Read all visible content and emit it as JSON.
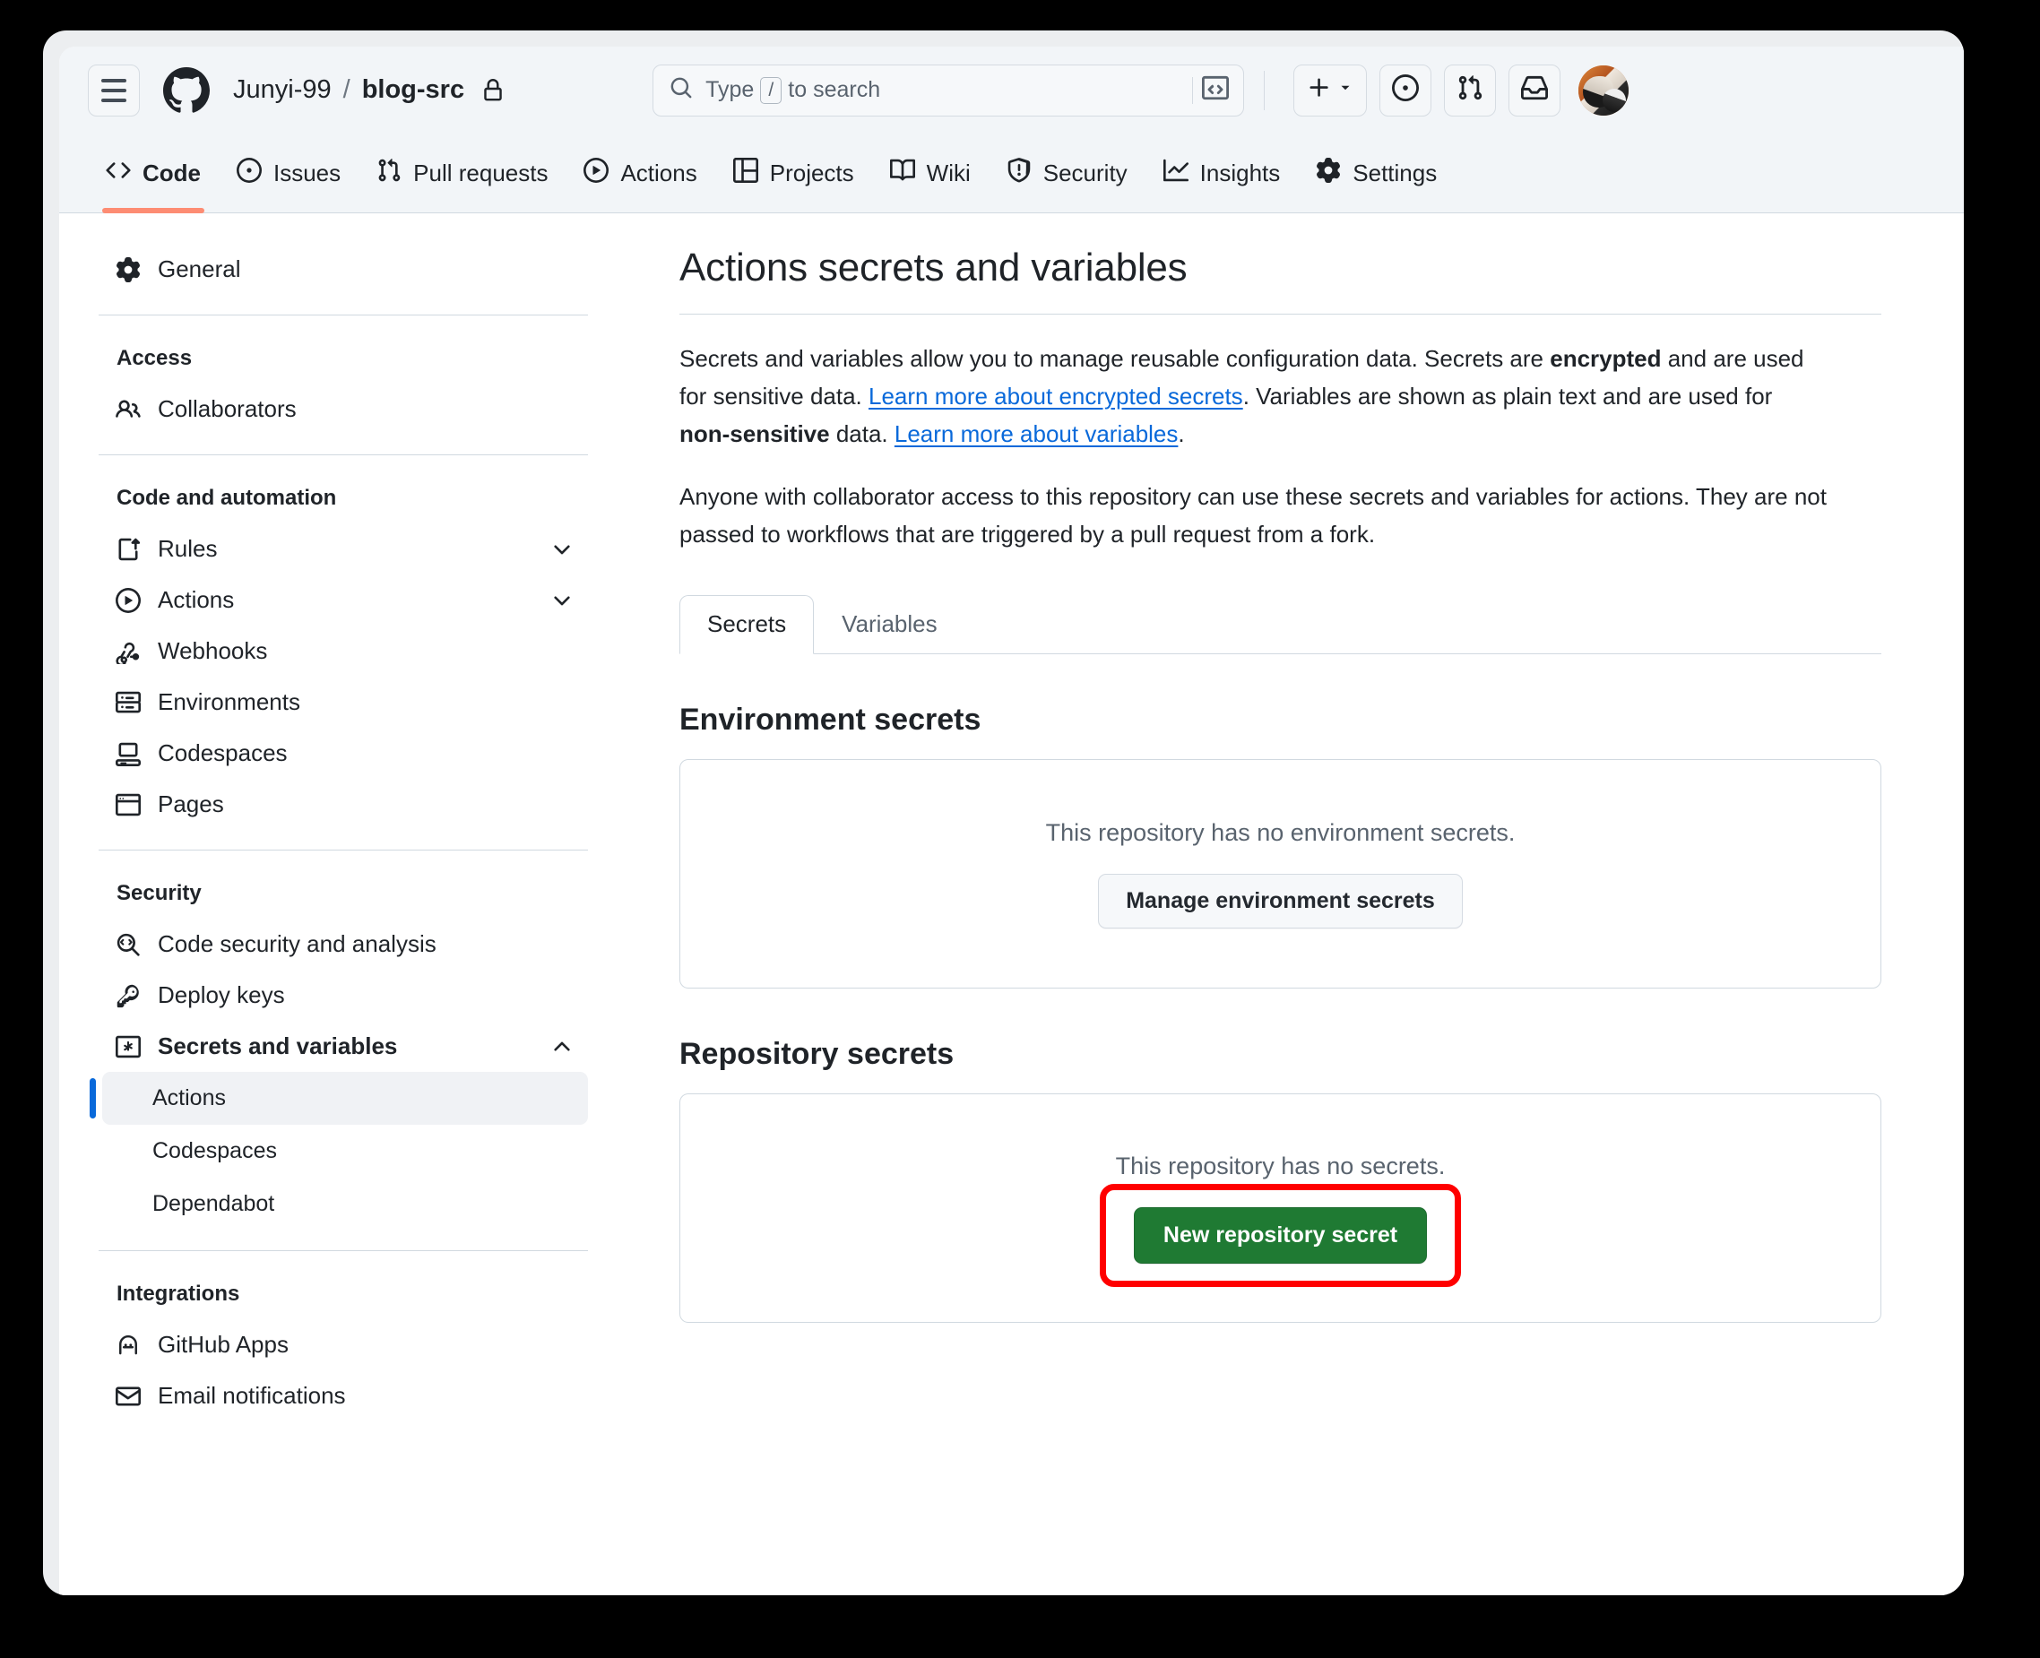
{
  "header": {
    "menu_icon": "hamburger-icon",
    "logo_icon": "github-mark-icon",
    "owner": "Junyi-99",
    "separator": "/",
    "repo": "blog-src",
    "visibility_icon": "lock-icon",
    "search": {
      "icon": "search-icon",
      "placeholder_prefix": "Type",
      "placeholder_key": "/",
      "placeholder_suffix": "to search",
      "command_palette_icon": "terminal-icon"
    },
    "actions": [
      {
        "name": "create-new-menu",
        "icon": "plus-icon",
        "chevron": "chevron-down-icon"
      },
      {
        "name": "issues-shortcut",
        "icon": "issue-opened-icon"
      },
      {
        "name": "pull-requests-shortcut",
        "icon": "git-pull-request-icon"
      },
      {
        "name": "notifications-inbox",
        "icon": "inbox-icon"
      },
      {
        "name": "user-avatar",
        "icon": "avatar"
      }
    ]
  },
  "repo_nav": {
    "tabs": [
      {
        "label": "Code",
        "icon": "code-icon",
        "active": true
      },
      {
        "label": "Issues",
        "icon": "issue-opened-icon",
        "active": false
      },
      {
        "label": "Pull requests",
        "icon": "git-pull-request-icon",
        "active": false
      },
      {
        "label": "Actions",
        "icon": "play-icon",
        "active": false
      },
      {
        "label": "Projects",
        "icon": "table-icon",
        "active": false
      },
      {
        "label": "Wiki",
        "icon": "book-icon",
        "active": false
      },
      {
        "label": "Security",
        "icon": "shield-icon",
        "active": false
      },
      {
        "label": "Insights",
        "icon": "graph-icon",
        "active": false
      },
      {
        "label": "Settings",
        "icon": "gear-icon",
        "active": false
      }
    ]
  },
  "sidebar": {
    "general": {
      "label": "General",
      "icon": "gear-icon"
    },
    "groups": [
      {
        "heading": "Access",
        "items": [
          {
            "label": "Collaborators",
            "icon": "people-icon",
            "expandable": false
          }
        ]
      },
      {
        "heading": "Code and automation",
        "items": [
          {
            "label": "Rules",
            "icon": "rules-icon",
            "expandable": true,
            "expanded": false
          },
          {
            "label": "Actions",
            "icon": "play-icon",
            "expandable": true,
            "expanded": false
          },
          {
            "label": "Webhooks",
            "icon": "webhook-icon",
            "expandable": false
          },
          {
            "label": "Environments",
            "icon": "server-icon",
            "expandable": false
          },
          {
            "label": "Codespaces",
            "icon": "codespaces-icon",
            "expandable": false
          },
          {
            "label": "Pages",
            "icon": "browser-icon",
            "expandable": false
          }
        ]
      },
      {
        "heading": "Security",
        "items": [
          {
            "label": "Code security and analysis",
            "icon": "code-scan-icon",
            "expandable": false
          },
          {
            "label": "Deploy keys",
            "icon": "key-icon",
            "expandable": false
          },
          {
            "label": "Secrets and variables",
            "icon": "asterisk-box-icon",
            "expandable": true,
            "expanded": true
          }
        ],
        "subitems": [
          {
            "label": "Actions",
            "selected": true
          },
          {
            "label": "Codespaces",
            "selected": false
          },
          {
            "label": "Dependabot",
            "selected": false
          }
        ]
      },
      {
        "heading": "Integrations",
        "items": [
          {
            "label": "GitHub Apps",
            "icon": "apps-icon",
            "expandable": false
          },
          {
            "label": "Email notifications",
            "icon": "mail-icon",
            "expandable": false
          }
        ]
      }
    ]
  },
  "main": {
    "title": "Actions secrets and variables",
    "intro": {
      "p1_a": "Secrets and variables allow you to manage reusable configuration data. Secrets are ",
      "p1_b_encrypted": "encrypted",
      "p1_c": " and are used for sensitive data. ",
      "p1_link1": "Learn more about encrypted secrets",
      "p1_d": ". Variables are shown as plain text and are used for ",
      "p1_b_nonsensitive": "non-sensitive",
      "p1_e": " data. ",
      "p1_link2": "Learn more about variables",
      "p1_f": ".",
      "p2": "Anyone with collaborator access to this repository can use these secrets and variables for actions. They are not passed to workflows that are triggered by a pull request from a fork."
    },
    "tabs": [
      {
        "label": "Secrets",
        "active": true
      },
      {
        "label": "Variables",
        "active": false
      }
    ],
    "environment_secrets": {
      "heading": "Environment secrets",
      "empty_message": "This repository has no environment secrets.",
      "button_label": "Manage environment secrets"
    },
    "repository_secrets": {
      "heading": "Repository secrets",
      "empty_message": "This repository has no secrets.",
      "button_label": "New repository secret",
      "button_highlighted": true
    }
  },
  "colors": {
    "accent_blue": "#0969da",
    "primary_green": "#1f7a33",
    "active_tab_underline": "#fd8c73",
    "annotation_red": "#ff0000",
    "header_bg": "#f2f5f8"
  }
}
